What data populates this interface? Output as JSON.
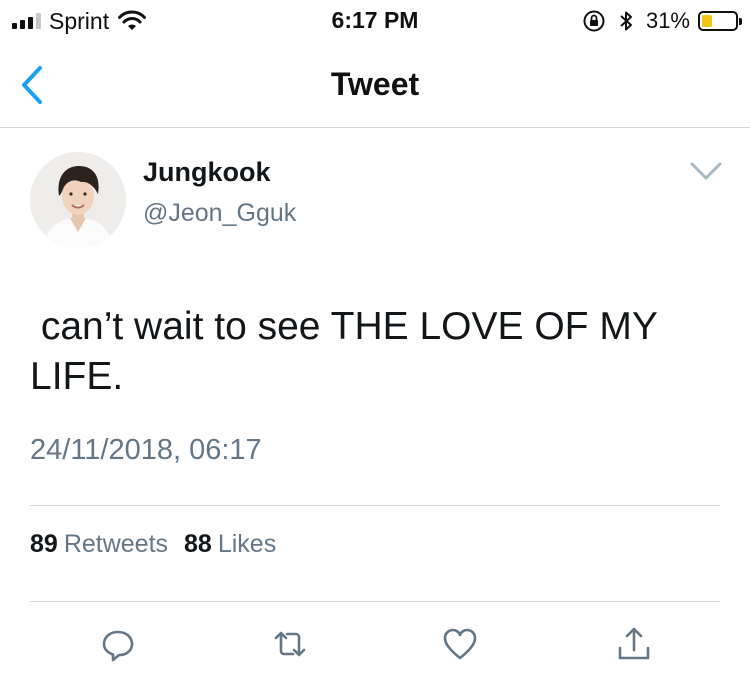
{
  "status_bar": {
    "carrier": "Sprint",
    "time": "6:17 PM",
    "battery_percent": "31%",
    "battery_level": 0.31,
    "icons": [
      "signal-icon",
      "wifi-icon",
      "rotation-lock-icon",
      "bluetooth-icon",
      "battery-icon"
    ]
  },
  "nav": {
    "title": "Tweet",
    "back_icon": "chevron-left-icon"
  },
  "tweet": {
    "display_name": "Jungkook",
    "handle": "@Jeon_Gguk",
    "text": " can’t wait to see THE LOVE OF MY LIFE.",
    "timestamp": "24/11/2018, 06:17",
    "retweets_count": "89",
    "retweets_label": "Retweets",
    "likes_count": "88",
    "likes_label": "Likes"
  },
  "actions": [
    "reply-icon",
    "retweet-icon",
    "like-icon",
    "share-icon"
  ],
  "colors": {
    "accent": "#1da1f2",
    "text_primary": "#14171a",
    "text_secondary": "#657786",
    "divider": "#d6d9dc",
    "battery": "#f5c518"
  }
}
